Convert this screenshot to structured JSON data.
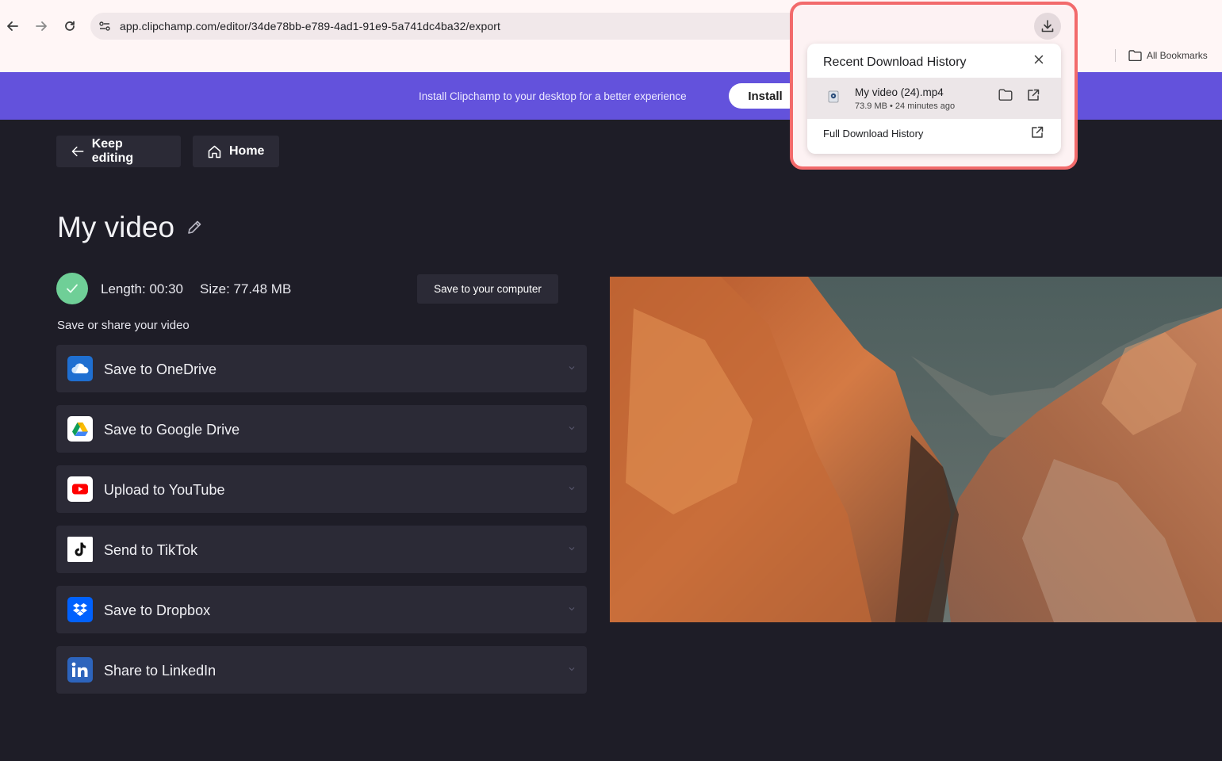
{
  "browser": {
    "url": "app.clipchamp.com/editor/34de78bb-e789-4ad1-91e9-5a741dc4ba32/export",
    "bookmarks_label": "All Bookmarks"
  },
  "banner": {
    "message": "Install Clipchamp to your desktop for a better experience",
    "install_label": "Install"
  },
  "toolbar": {
    "keep_editing_label": "Keep editing",
    "home_label": "Home"
  },
  "video": {
    "title": "My video",
    "length_text": "Length: 00:30",
    "size_text": "Size: 77.48 MB",
    "save_computer_label": "Save to your computer",
    "section_label": "Save or share your video"
  },
  "share_options": [
    {
      "label": "Save to OneDrive",
      "icon": "onedrive-icon",
      "color": "#0f6cbd"
    },
    {
      "label": "Save to Google Drive",
      "icon": "google-drive-icon",
      "color": "#ffffff"
    },
    {
      "label": "Upload to YouTube",
      "icon": "youtube-icon",
      "color": "#ffffff"
    },
    {
      "label": "Send to TikTok",
      "icon": "tiktok-icon",
      "color": "#ffffff"
    },
    {
      "label": "Save to Dropbox",
      "icon": "dropbox-icon",
      "color": "#0061fe"
    },
    {
      "label": "Share to LinkedIn",
      "icon": "linkedin-icon",
      "color": "#2d64bc"
    }
  ],
  "download_popup": {
    "title": "Recent Download History",
    "file_name": "My video (24).mp4",
    "file_meta": "73.9 MB • 24 minutes ago",
    "full_history_label": "Full Download History"
  },
  "colors": {
    "banner": "#6352dc",
    "background": "#1e1d27",
    "card": "#2b2a36",
    "success": "#6fcf97",
    "highlight": "#f26a6b"
  }
}
